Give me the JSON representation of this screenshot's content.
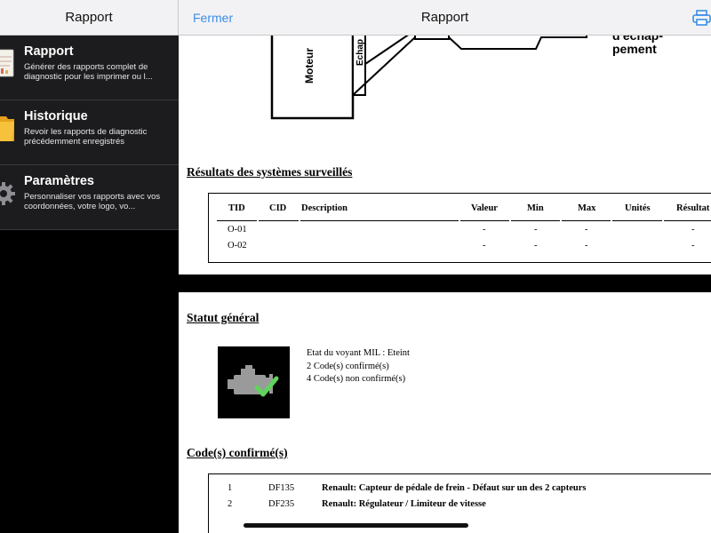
{
  "sidebar": {
    "title": "Rapport",
    "items": [
      {
        "title": "Rapport",
        "description": "Générer des rapports complet de diagnostic pour les imprimer ou l...",
        "icon": "report-document-icon"
      },
      {
        "title": "Historique",
        "description": "Revoir les rapports de diagnostic précédemment enregistrés",
        "icon": "folder-icon"
      },
      {
        "title": "Paramètres",
        "description": "Personnaliser vos rapports avec vos coordonnées, votre logo, vo...",
        "icon": "gear-icon"
      }
    ]
  },
  "header": {
    "close_label": "Fermer",
    "title": "Rapport",
    "print_icon": "printer-icon",
    "accent_color": "#3a8ee6"
  },
  "document": {
    "diagram": {
      "engine_label": "Moteur",
      "exhaust_label": "Echap",
      "exhaust_line_1": "d'échap-",
      "exhaust_line_2": "pement"
    },
    "monitored_systems": {
      "title": "Résultats des systèmes surveillés",
      "columns": [
        "TID",
        "CID",
        "Description",
        "Valeur",
        "Min",
        "Max",
        "Unités",
        "Résultat"
      ],
      "rows": [
        {
          "tid": "O-01",
          "cid": "",
          "description": "",
          "valeur": "-",
          "min": "-",
          "max": "-",
          "unites": "",
          "resultat": "-"
        },
        {
          "tid": "O-02",
          "cid": "",
          "description": "",
          "valeur": "-",
          "min": "-",
          "max": "-",
          "unites": "",
          "resultat": "-"
        }
      ]
    },
    "general_status": {
      "title": "Statut général",
      "icon": "engine-check-icon",
      "lines": [
        "Etat du voyant MIL : Eteint",
        "2 Code(s) confirmé(s)",
        "4 Code(s) non confirmé(s)"
      ]
    },
    "confirmed_codes": {
      "title": "Code(s) confirmé(s)",
      "rows": [
        {
          "num": "1",
          "code": "DF135",
          "description": "Renault: Capteur de pédale de frein - Défaut sur un des 2 capteurs"
        },
        {
          "num": "2",
          "code": "DF235",
          "description": "Renault: Régulateur / Limiteur de vitesse"
        }
      ]
    }
  }
}
